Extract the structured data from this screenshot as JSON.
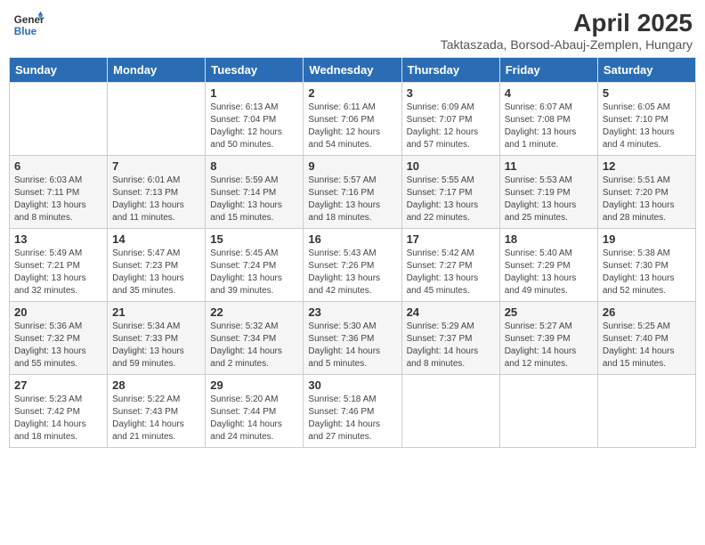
{
  "header": {
    "logo_line1": "General",
    "logo_line2": "Blue",
    "title": "April 2025",
    "subtitle": "Taktaszada, Borsod-Abauj-Zemplen, Hungary"
  },
  "weekdays": [
    "Sunday",
    "Monday",
    "Tuesday",
    "Wednesday",
    "Thursday",
    "Friday",
    "Saturday"
  ],
  "weeks": [
    [
      {
        "day": "",
        "info": ""
      },
      {
        "day": "",
        "info": ""
      },
      {
        "day": "1",
        "info": "Sunrise: 6:13 AM\nSunset: 7:04 PM\nDaylight: 12 hours and 50 minutes."
      },
      {
        "day": "2",
        "info": "Sunrise: 6:11 AM\nSunset: 7:06 PM\nDaylight: 12 hours and 54 minutes."
      },
      {
        "day": "3",
        "info": "Sunrise: 6:09 AM\nSunset: 7:07 PM\nDaylight: 12 hours and 57 minutes."
      },
      {
        "day": "4",
        "info": "Sunrise: 6:07 AM\nSunset: 7:08 PM\nDaylight: 13 hours and 1 minute."
      },
      {
        "day": "5",
        "info": "Sunrise: 6:05 AM\nSunset: 7:10 PM\nDaylight: 13 hours and 4 minutes."
      }
    ],
    [
      {
        "day": "6",
        "info": "Sunrise: 6:03 AM\nSunset: 7:11 PM\nDaylight: 13 hours and 8 minutes."
      },
      {
        "day": "7",
        "info": "Sunrise: 6:01 AM\nSunset: 7:13 PM\nDaylight: 13 hours and 11 minutes."
      },
      {
        "day": "8",
        "info": "Sunrise: 5:59 AM\nSunset: 7:14 PM\nDaylight: 13 hours and 15 minutes."
      },
      {
        "day": "9",
        "info": "Sunrise: 5:57 AM\nSunset: 7:16 PM\nDaylight: 13 hours and 18 minutes."
      },
      {
        "day": "10",
        "info": "Sunrise: 5:55 AM\nSunset: 7:17 PM\nDaylight: 13 hours and 22 minutes."
      },
      {
        "day": "11",
        "info": "Sunrise: 5:53 AM\nSunset: 7:19 PM\nDaylight: 13 hours and 25 minutes."
      },
      {
        "day": "12",
        "info": "Sunrise: 5:51 AM\nSunset: 7:20 PM\nDaylight: 13 hours and 28 minutes."
      }
    ],
    [
      {
        "day": "13",
        "info": "Sunrise: 5:49 AM\nSunset: 7:21 PM\nDaylight: 13 hours and 32 minutes."
      },
      {
        "day": "14",
        "info": "Sunrise: 5:47 AM\nSunset: 7:23 PM\nDaylight: 13 hours and 35 minutes."
      },
      {
        "day": "15",
        "info": "Sunrise: 5:45 AM\nSunset: 7:24 PM\nDaylight: 13 hours and 39 minutes."
      },
      {
        "day": "16",
        "info": "Sunrise: 5:43 AM\nSunset: 7:26 PM\nDaylight: 13 hours and 42 minutes."
      },
      {
        "day": "17",
        "info": "Sunrise: 5:42 AM\nSunset: 7:27 PM\nDaylight: 13 hours and 45 minutes."
      },
      {
        "day": "18",
        "info": "Sunrise: 5:40 AM\nSunset: 7:29 PM\nDaylight: 13 hours and 49 minutes."
      },
      {
        "day": "19",
        "info": "Sunrise: 5:38 AM\nSunset: 7:30 PM\nDaylight: 13 hours and 52 minutes."
      }
    ],
    [
      {
        "day": "20",
        "info": "Sunrise: 5:36 AM\nSunset: 7:32 PM\nDaylight: 13 hours and 55 minutes."
      },
      {
        "day": "21",
        "info": "Sunrise: 5:34 AM\nSunset: 7:33 PM\nDaylight: 13 hours and 59 minutes."
      },
      {
        "day": "22",
        "info": "Sunrise: 5:32 AM\nSunset: 7:34 PM\nDaylight: 14 hours and 2 minutes."
      },
      {
        "day": "23",
        "info": "Sunrise: 5:30 AM\nSunset: 7:36 PM\nDaylight: 14 hours and 5 minutes."
      },
      {
        "day": "24",
        "info": "Sunrise: 5:29 AM\nSunset: 7:37 PM\nDaylight: 14 hours and 8 minutes."
      },
      {
        "day": "25",
        "info": "Sunrise: 5:27 AM\nSunset: 7:39 PM\nDaylight: 14 hours and 12 minutes."
      },
      {
        "day": "26",
        "info": "Sunrise: 5:25 AM\nSunset: 7:40 PM\nDaylight: 14 hours and 15 minutes."
      }
    ],
    [
      {
        "day": "27",
        "info": "Sunrise: 5:23 AM\nSunset: 7:42 PM\nDaylight: 14 hours and 18 minutes."
      },
      {
        "day": "28",
        "info": "Sunrise: 5:22 AM\nSunset: 7:43 PM\nDaylight: 14 hours and 21 minutes."
      },
      {
        "day": "29",
        "info": "Sunrise: 5:20 AM\nSunset: 7:44 PM\nDaylight: 14 hours and 24 minutes."
      },
      {
        "day": "30",
        "info": "Sunrise: 5:18 AM\nSunset: 7:46 PM\nDaylight: 14 hours and 27 minutes."
      },
      {
        "day": "",
        "info": ""
      },
      {
        "day": "",
        "info": ""
      },
      {
        "day": "",
        "info": ""
      }
    ]
  ]
}
